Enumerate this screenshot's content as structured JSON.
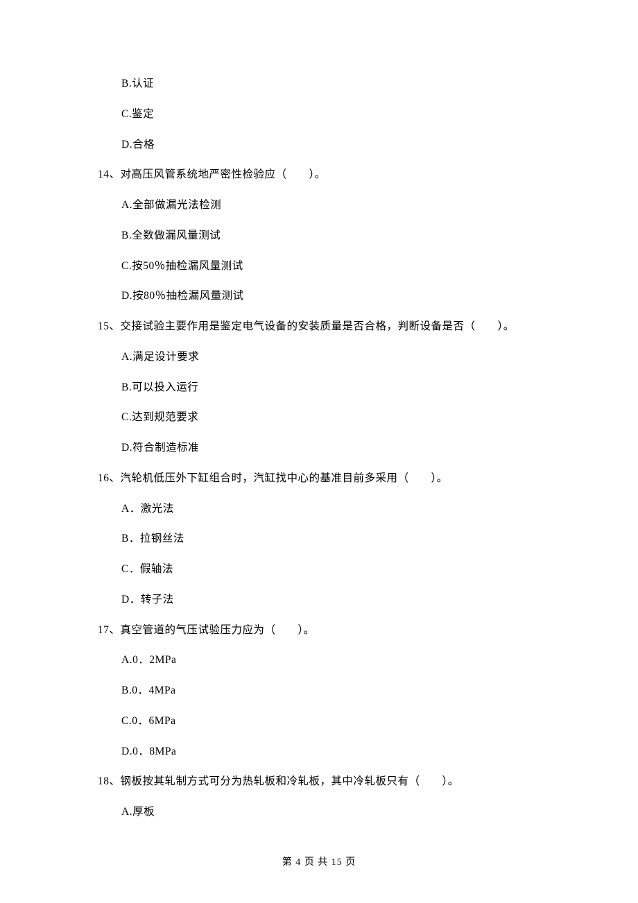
{
  "q13": {
    "optB": "B.认证",
    "optC": "C.鉴定",
    "optD": "D.合格"
  },
  "q14": {
    "stem": "14、对高压风管系统地严密性检验应（　　）。",
    "optA": "A.全部做漏光法检测",
    "optB": "B.全数做漏风量测试",
    "optC": "C.按50％抽检漏风量测试",
    "optD": "D.按80％抽检漏风量测试"
  },
  "q15": {
    "stem": "15、交接试验主要作用是鉴定电气设备的安装质量是否合格，判断设备是否（　　）。",
    "optA": "A.满足设计要求",
    "optB": "B.可以投入运行",
    "optC": "C.达到规范要求",
    "optD": "D.符合制造标准"
  },
  "q16": {
    "stem": "16、汽轮机低压外下缸组合时，汽缸找中心的基准目前多采用（　　）。",
    "optA": "A．激光法",
    "optB": "B．拉钢丝法",
    "optC": "C．假轴法",
    "optD": "D．转子法"
  },
  "q17": {
    "stem": "17、真空管道的气压试验压力应为（　　）。",
    "optA": "A.0．2MPa",
    "optB": "B.0．4MPa",
    "optC": "C.0．6MPa",
    "optD": "D.0．8MPa"
  },
  "q18": {
    "stem": "18、钢板按其轧制方式可分为热轧板和冷轧板，其中冷轧板只有（　　）。",
    "optA": "A.厚板"
  },
  "footer": "第 4 页 共 15 页"
}
